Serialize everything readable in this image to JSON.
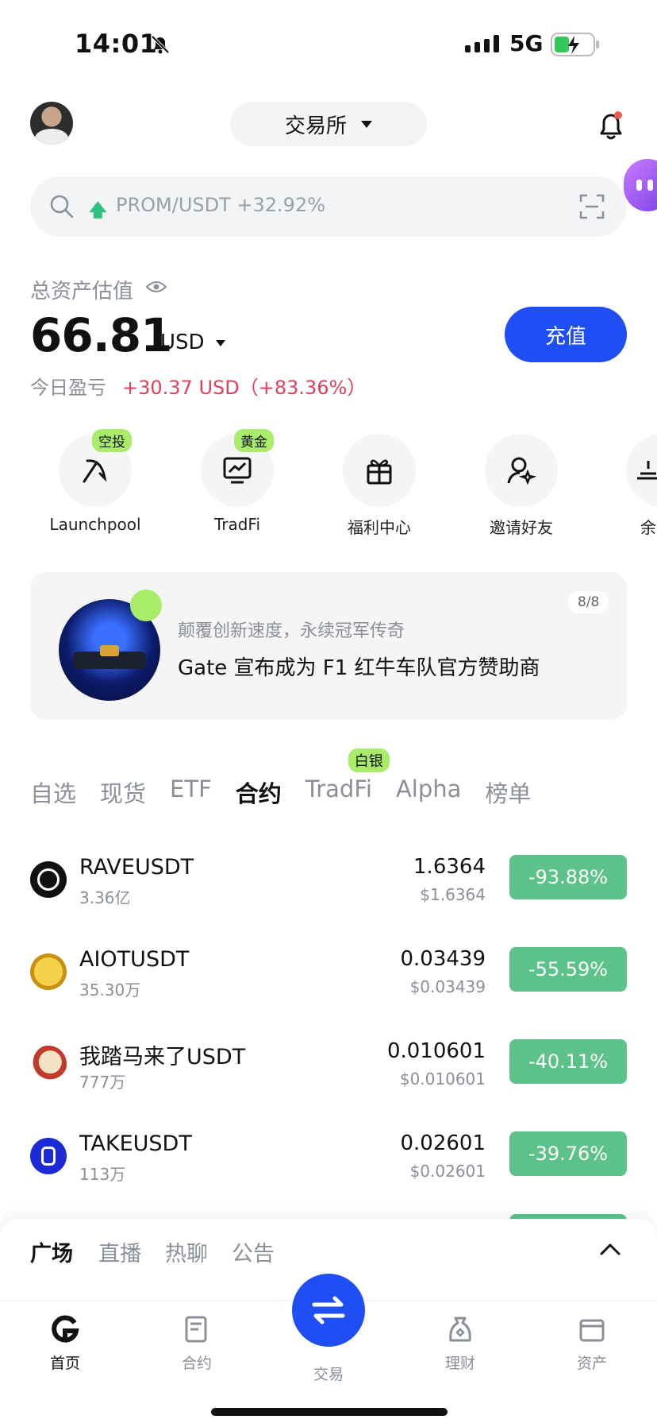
{
  "status_bar": {
    "time": "14:01",
    "network": "5G"
  },
  "header": {
    "exchange_label": "交易所"
  },
  "search": {
    "ticker_text": "PROM/USDT +32.92%"
  },
  "assets": {
    "title": "总资产估值",
    "amount": "66.81",
    "unit": "USD",
    "pnl_label": "今日盈亏",
    "pnl_value": "+30.37 USD（+83.36%）",
    "deposit_label": "充值"
  },
  "quick_actions": [
    {
      "label": "Launchpool",
      "badge": "空投",
      "icon": "launchpool-icon"
    },
    {
      "label": "TradFi",
      "badge": "黄金",
      "icon": "chart-monitor-icon"
    },
    {
      "label": "福利中心",
      "badge": "",
      "icon": "gift-icon"
    },
    {
      "label": "邀请好友",
      "badge": "",
      "icon": "invite-user-icon"
    },
    {
      "label": "余",
      "badge": "",
      "icon": "savings-icon"
    }
  ],
  "banner": {
    "subtitle": "颠覆创新速度，永续冠军传奇",
    "title": "Gate 宣布成为 F1 红牛车队官方赞助商",
    "page": "8/8"
  },
  "market_tabs": {
    "items": [
      "自选",
      "现货",
      "ETF",
      "合约",
      "TradFi",
      "Alpha",
      "榜单"
    ],
    "active": "合约",
    "tradfi_badge": "白银"
  },
  "market_rows": [
    {
      "symbol": "RAVEUSDT",
      "volume": "3.36亿",
      "price": "1.6364",
      "price_usd": "$1.6364",
      "change": "-93.88%"
    },
    {
      "symbol": "AIOTUSDT",
      "volume": "35.30万",
      "price": "0.03439",
      "price_usd": "$0.03439",
      "change": "-55.59%"
    },
    {
      "symbol": "我踏马来了USDT",
      "volume": "777万",
      "price": "0.010601",
      "price_usd": "$0.010601",
      "change": "-40.11%"
    },
    {
      "symbol": "TAKEUSDT",
      "volume": "113万",
      "price": "0.02601",
      "price_usd": "$0.02601",
      "change": "-39.76%"
    }
  ],
  "colors": {
    "accent": "#1f4ef5",
    "negative_badge": "#5cc28a",
    "pnl_positive": "#e0405a",
    "badge_green": "#a8ec6a"
  },
  "bottom_sheet": {
    "tabs": [
      "广场",
      "直播",
      "热聊",
      "公告"
    ]
  },
  "bottom_nav": {
    "items": [
      "首页",
      "合约",
      "交易",
      "理财",
      "资产"
    ]
  }
}
